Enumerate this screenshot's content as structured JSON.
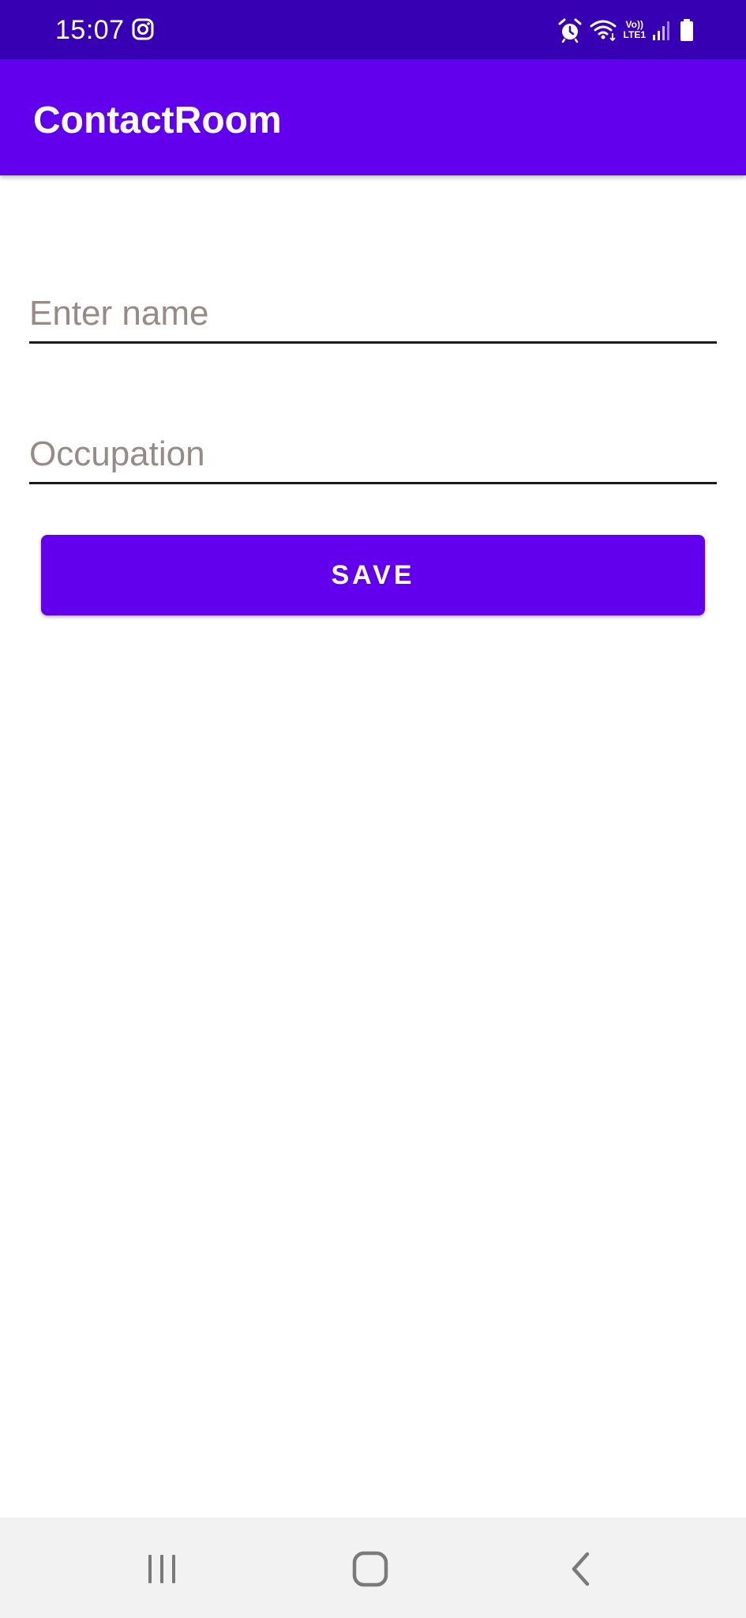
{
  "status_bar": {
    "time": "15:07",
    "left_icons": [
      "instagram-icon"
    ],
    "right_icons": [
      "alarm-icon",
      "wifi-icon",
      "volte-icon",
      "signal-icon",
      "battery-icon"
    ],
    "volte_line1": "Vo))",
    "volte_line2": "LTE1"
  },
  "app_bar": {
    "title": "ContactRoom"
  },
  "form": {
    "name_placeholder": "Enter name",
    "name_value": "",
    "occupation_placeholder": "Occupation",
    "occupation_value": "",
    "save_label": "SAVE"
  },
  "nav_bar": {
    "buttons": [
      "recents-icon",
      "home-icon",
      "back-icon"
    ]
  },
  "colors": {
    "status_bar": "#3700b3",
    "primary": "#6200ee",
    "placeholder": "#978b87",
    "nav_bar": "#f2f2f2"
  }
}
